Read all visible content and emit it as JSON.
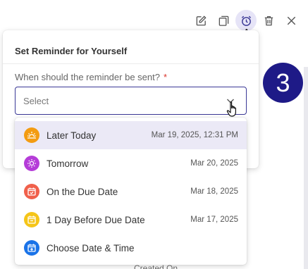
{
  "toolbar": {
    "icons": [
      "edit-icon",
      "copy-icon",
      "alarm-clock-icon",
      "trash-icon",
      "close-icon"
    ],
    "active_color": "#e6e4f7"
  },
  "step_badge": "3",
  "popover": {
    "title": "Set Reminder for Yourself",
    "field_label": "When should the reminder be sent?",
    "required_mark": "*",
    "select_placeholder": "Select"
  },
  "options": [
    {
      "label": "Later Today",
      "date": "Mar 19, 2025, 12:31 PM",
      "icon": "sunrise-icon",
      "color": "#f39c12"
    },
    {
      "label": "Tomorrow",
      "date": "Mar 20, 2025",
      "icon": "sun-icon",
      "color": "#b53cd8"
    },
    {
      "label": "On the Due Date",
      "date": "Mar 18, 2025",
      "icon": "calendar-check-icon",
      "color": "#f0604b"
    },
    {
      "label": "1 Day Before Due Date",
      "date": "Mar 17, 2025",
      "icon": "calendar-icon",
      "color": "#f5c518"
    },
    {
      "label": "Choose Date & Time",
      "date": "",
      "icon": "calendar-plus-icon",
      "color": "#1a73e8"
    }
  ],
  "footer_peek": "Created On",
  "colors": {
    "brand": "#3a3896",
    "badge": "#1e1a87",
    "highlight": "#ebe9f6",
    "required": "#d9342b"
  }
}
